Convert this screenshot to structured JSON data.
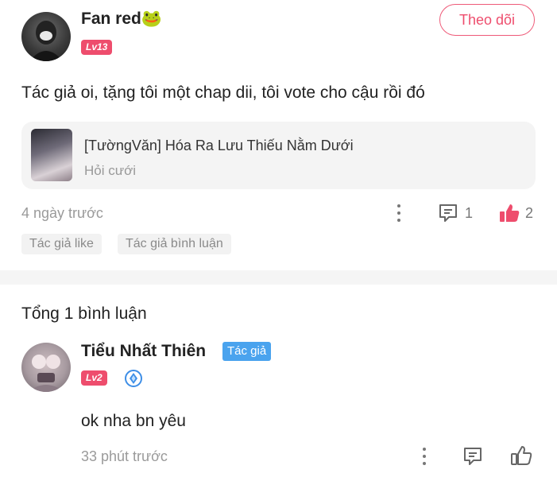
{
  "post": {
    "username": "Fan red🐸",
    "level": "Lv13",
    "follow_label": "Theo dõi",
    "text": "Tác giả oi, tặng tôi một chap dii, tôi vote cho cậu rồi đó",
    "story": {
      "title": "[TườngVăn] Hóa Ra Lưu Thiếu Nằm Dưới",
      "subtitle": "Hỏi cưới"
    },
    "time": "4 ngày trước",
    "comment_count": "1",
    "like_count": "2",
    "tags": [
      "Tác giả like",
      "Tác giả bình luận"
    ],
    "accent_color": "#ee4d6d"
  },
  "comments": {
    "total_label": "Tổng 1 bình luận",
    "items": [
      {
        "username": "Tiểu Nhất Thiên",
        "author_tag": "Tác giả",
        "level": "Lv2",
        "text": "ok nha bn yêu",
        "time": "33 phút trước"
      }
    ]
  },
  "icons": {
    "more": "more-vertical-icon",
    "comment": "comment-icon",
    "like_filled": "thumbs-up-filled-icon",
    "like_outline": "thumbs-up-outline-icon",
    "vip": "vip-badge-icon"
  }
}
